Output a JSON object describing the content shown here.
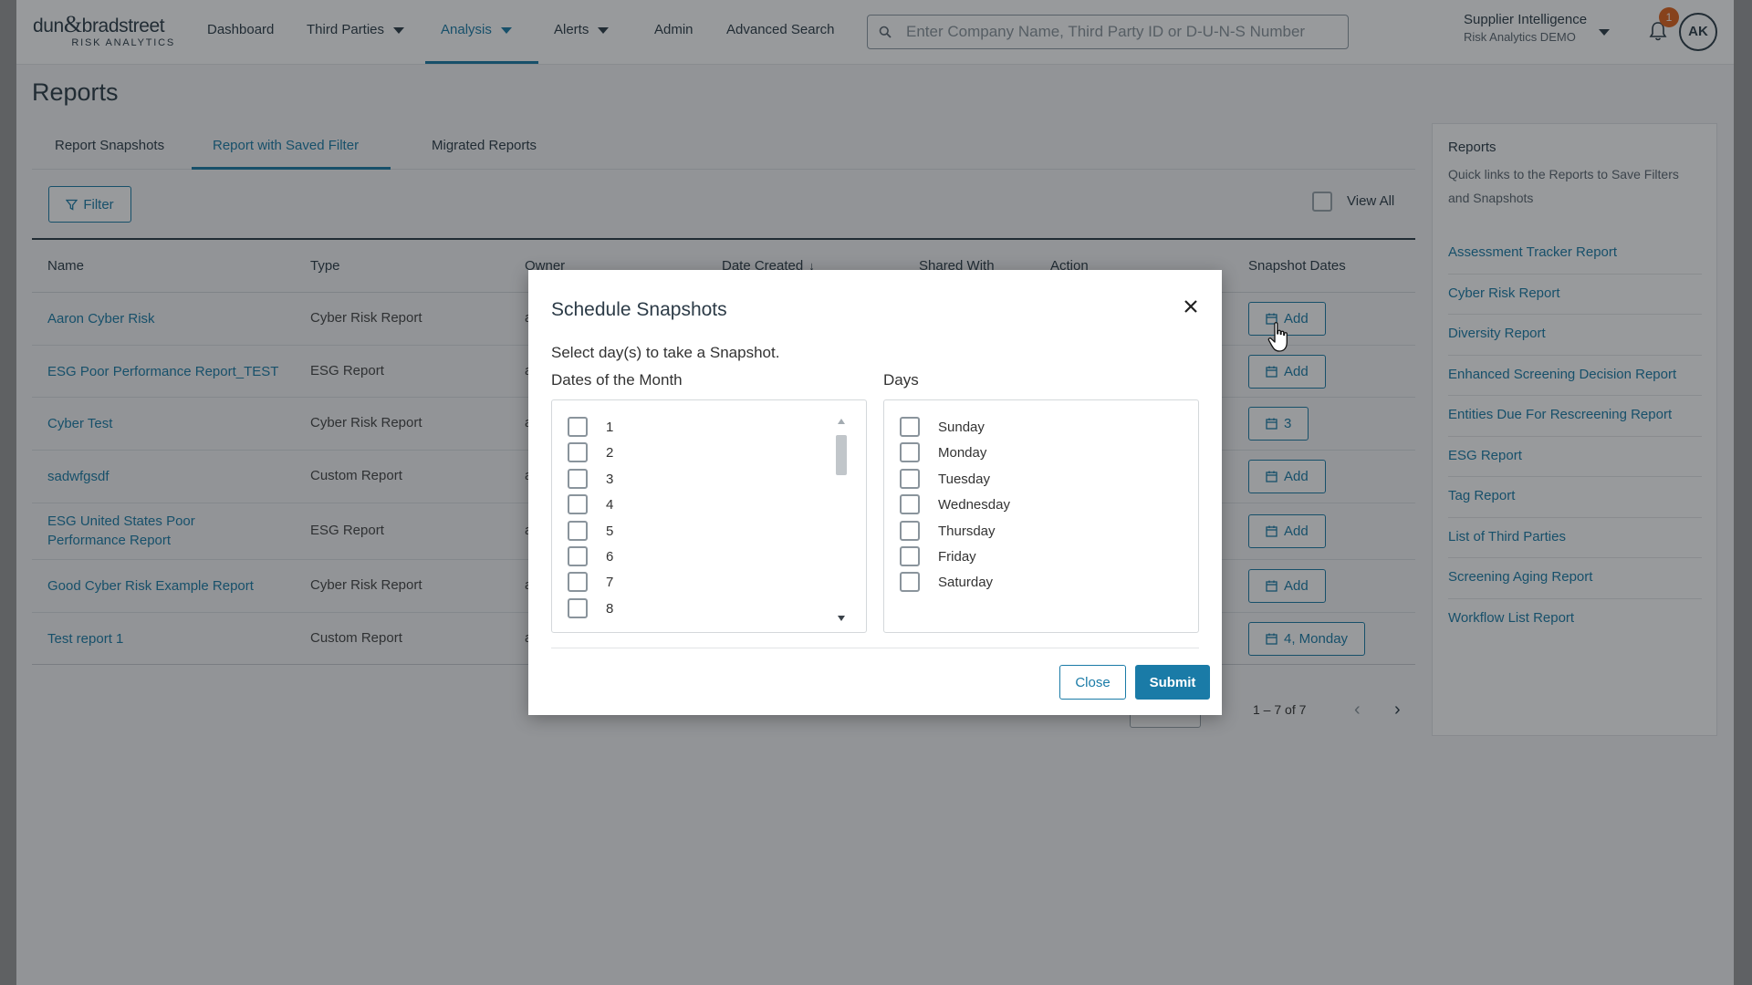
{
  "brand": {
    "name": "dun & bradstreet",
    "sub": "RISK ANALYTICS"
  },
  "nav": {
    "dashboard": "Dashboard",
    "third_parties": "Third Parties",
    "analysis": "Analysis",
    "alerts": "Alerts",
    "admin": "Admin",
    "advanced_search": "Advanced Search"
  },
  "search": {
    "placeholder": "Enter Company Name, Third Party ID or D-U-N-S Number",
    "value": ""
  },
  "account": {
    "title": "Supplier Intelligence",
    "subtitle": "Risk Analytics DEMO",
    "notifications": "1",
    "initials": "AK"
  },
  "page": {
    "title": "Reports"
  },
  "tabs": [
    "Report Snapshots",
    "Report with Saved Filter",
    "Migrated Reports"
  ],
  "toolbar": {
    "filter": "Filter",
    "view_all": "View All"
  },
  "table": {
    "headers": {
      "name": "Name",
      "type": "Type",
      "owner": "Owner",
      "date_created": "Date Created",
      "shared_with": "Shared With",
      "action": "Action",
      "snapshot_dates": "Snapshot Dates"
    },
    "rows": [
      {
        "name": "Aaron Cyber Risk",
        "type": "Cyber Risk Report",
        "owner": "abr",
        "snapshot": "Add"
      },
      {
        "name": "ESG Poor Performance Report_TEST",
        "type": "ESG Report",
        "owner": "abr",
        "snapshot": "Add"
      },
      {
        "name": "Cyber Test",
        "type": "Cyber Risk Report",
        "owner": "abr",
        "snapshot": "3"
      },
      {
        "name": "sadwfgsdf",
        "type": "Custom Report",
        "owner": "abr",
        "snapshot": "Add"
      },
      {
        "name": "ESG United States Poor",
        "name2": "Performance Report",
        "type": "ESG Report",
        "owner": "abr",
        "snapshot": "Add"
      },
      {
        "name": "Good Cyber Risk Example Report",
        "type": "Cyber Risk Report",
        "owner": "abr",
        "snapshot": "Add"
      },
      {
        "name": "Test report 1",
        "type": "Custom Report",
        "owner": "abr",
        "snapshot": "4, Monday"
      }
    ]
  },
  "pagination": {
    "range": "1 – 7 of 7"
  },
  "side_panel": {
    "title": "Reports",
    "description": "Quick links to the Reports to Save Filters and Snapshots",
    "links": [
      "Assessment Tracker Report",
      "Cyber Risk Report",
      "Diversity Report",
      "Enhanced Screening Decision Report",
      "Entities Due For Rescreening Report",
      "ESG Report",
      "Tag Report",
      "List of Third Parties",
      "Screening Aging Report",
      "Workflow List Report"
    ]
  },
  "modal": {
    "title": "Schedule Snapshots",
    "instruction": "Select day(s) to take a Snapshot.",
    "dates_label": "Dates of the Month",
    "days_label": "Days",
    "dates": [
      "1",
      "2",
      "3",
      "4",
      "5",
      "6",
      "7",
      "8"
    ],
    "days": [
      "Sunday",
      "Monday",
      "Tuesday",
      "Wednesday",
      "Thursday",
      "Friday",
      "Saturday"
    ],
    "close": "Close",
    "submit": "Submit"
  },
  "colors": {
    "accent": "#1a7ba7",
    "badge": "#e0631b",
    "text": "#2c3b47"
  }
}
